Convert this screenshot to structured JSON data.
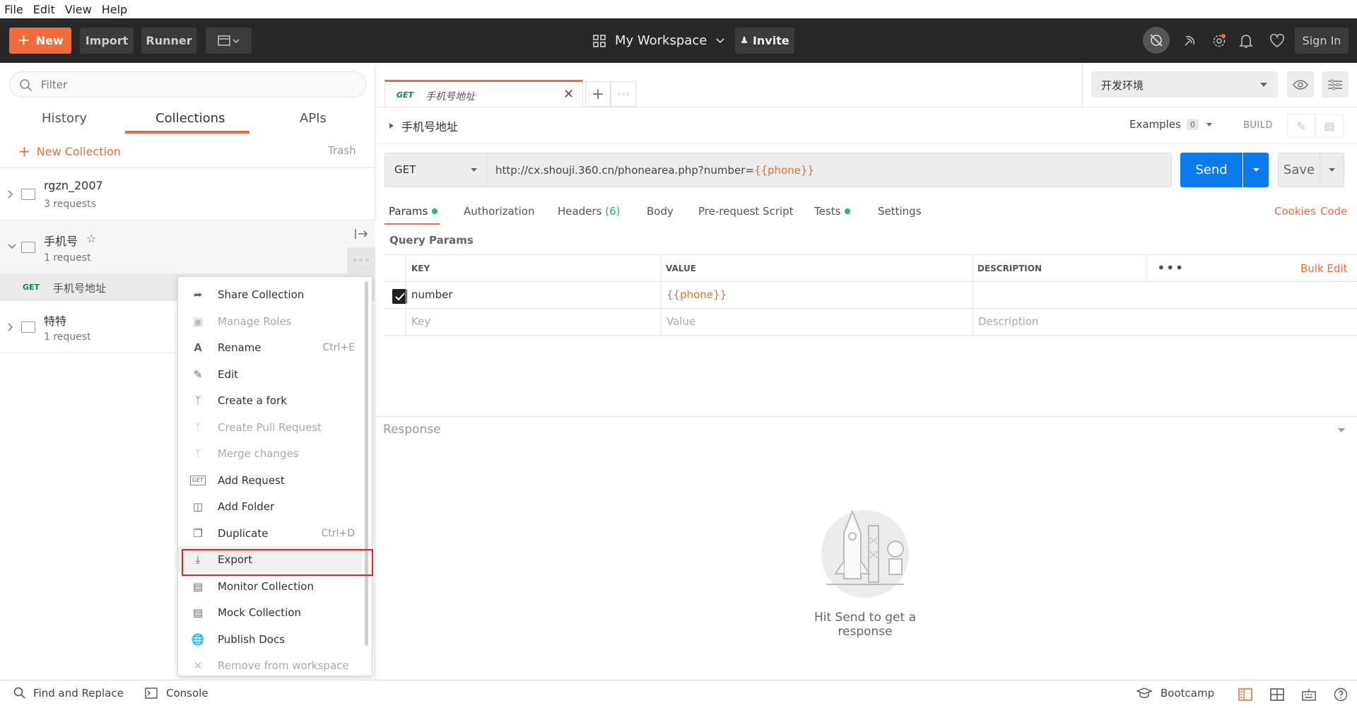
{
  "menubar": {
    "items": [
      "File",
      "Edit",
      "View",
      "Help"
    ]
  },
  "header": {
    "new_label": "New",
    "import_label": "Import",
    "runner_label": "Runner",
    "workspace": "My Workspace",
    "invite": "Invite",
    "signin": "Sign In",
    "accent": "#f26b3a"
  },
  "sidebar": {
    "filter_placeholder": "Filter",
    "tabs": [
      "History",
      "Collections",
      "APIs"
    ],
    "new_collection": "New Collection",
    "trash": "Trash",
    "collections": [
      {
        "name": "rgzn_2007",
        "sub": "3 requests"
      },
      {
        "name": "手机号",
        "sub": "1 request"
      },
      {
        "name": "特特",
        "sub": "1 request"
      }
    ],
    "request_method": "GET",
    "request_name": "手机号地址"
  },
  "context_menu": {
    "items": [
      {
        "label": "Share Collection",
        "shortcut": "",
        "icon": "share-icon"
      },
      {
        "label": "Manage Roles",
        "shortcut": "",
        "icon": "lock-icon"
      },
      {
        "label": "Rename",
        "shortcut": "Ctrl+E",
        "icon": "rename-icon"
      },
      {
        "label": "Edit",
        "shortcut": "",
        "icon": "pencil-icon"
      },
      {
        "label": "Create a fork",
        "shortcut": "",
        "icon": "fork-icon"
      },
      {
        "label": "Create Pull Request",
        "shortcut": "",
        "icon": "pull-request-icon"
      },
      {
        "label": "Merge changes",
        "shortcut": "",
        "icon": "merge-icon"
      },
      {
        "label": "Add Request",
        "shortcut": "",
        "icon": "get-request-icon"
      },
      {
        "label": "Add Folder",
        "shortcut": "",
        "icon": "add-folder-icon"
      },
      {
        "label": "Duplicate",
        "shortcut": "Ctrl+D",
        "icon": "duplicate-icon"
      },
      {
        "label": "Export",
        "shortcut": "",
        "icon": "download-icon"
      },
      {
        "label": "Monitor Collection",
        "shortcut": "",
        "icon": "monitor-icon"
      },
      {
        "label": "Mock Collection",
        "shortcut": "",
        "icon": "server-icon"
      },
      {
        "label": "Publish Docs",
        "shortcut": "",
        "icon": "globe-icon"
      },
      {
        "label": "Remove from workspace",
        "shortcut": "",
        "icon": "close-icon"
      }
    ],
    "highlight_color": "#e0242a"
  },
  "tab": {
    "method": "GET",
    "name": "手机号地址"
  },
  "environment": "开发环境",
  "request": {
    "title": "手机号地址",
    "examples_label": "Examples",
    "examples_count": "0",
    "build": "BUILD",
    "method": "GET",
    "url_base": "http://cx.shouji.360.cn/phonearea.php?number=",
    "url_var": "{{phone}}",
    "send": "Send",
    "save": "Save",
    "send_color": "#097bed"
  },
  "req_tabs": {
    "params": "Params",
    "authorization": "Authorization",
    "headers": "Headers",
    "headers_count": "(6)",
    "body": "Body",
    "prerequest": "Pre-request Script",
    "tests": "Tests",
    "settings": "Settings",
    "cookies": "Cookies",
    "code": "Code"
  },
  "params": {
    "section": "Query Params",
    "col_key": "KEY",
    "col_value": "VALUE",
    "col_desc": "DESCRIPTION",
    "bulk_edit": "Bulk Edit",
    "row_key": "number",
    "row_value": "{{phone}}",
    "ph_key": "Key",
    "ph_value": "Value",
    "ph_desc": "Description"
  },
  "response": {
    "title": "Response",
    "hint": "Hit Send to get a response"
  },
  "footer": {
    "find_replace": "Find and Replace",
    "console": "Console",
    "bootcamp": "Bootcamp"
  }
}
